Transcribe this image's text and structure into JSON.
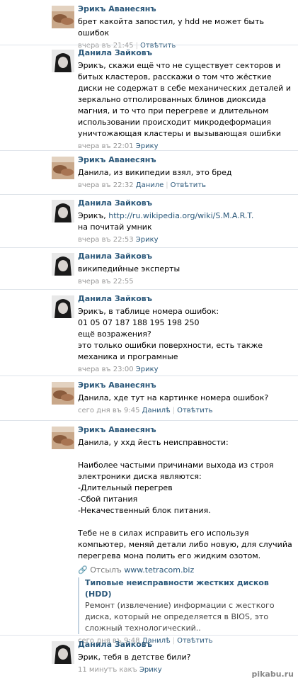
{
  "comments": [
    {
      "author": "Эрикъ Аванесянъ",
      "text": "брет какойта запостил, у hdd не может быть ошибок",
      "meta_time": "вчера въ 21:45",
      "meta_reply": "Отвѣтить",
      "avatar": "avatar-erik"
    },
    {
      "author": "Данила Зайковъ",
      "text": "Эрикъ, скажи ещё что не существует секторов и битых кластеров, расскажи о том что жёсткие диски не содержат в себе механических деталей и зеркально отполированных блинов диоксида магния, и то что при перегреве и длительном использовании происходит микродеформация уничтожающая кластеры и вызывающая ошибки",
      "meta_time": "вчера въ 22:01",
      "meta_to": "Эрику",
      "avatar": "avatar-danila"
    },
    {
      "author": "Эрикъ Аванесянъ",
      "text": "Данила, из википедии взял, это бред",
      "meta_time": "вчера въ 22:32",
      "meta_to": "Даниле",
      "meta_reply": "Отвѣтить",
      "avatar": "avatar-erik"
    },
    {
      "author": "Данила Зайковъ",
      "text_prefix": "Эрикъ, ",
      "link": "http://ru.wikipedia.org/wiki/S.M.A.R.T.",
      "text": "на почитай умник",
      "meta_time": "вчера въ 22:53",
      "meta_to": "Эрику",
      "avatar": "avatar-danila"
    },
    {
      "author": "Данила Зайковъ",
      "text": "википедийные эксперты",
      "meta_time": "вчера въ 22:55",
      "avatar": "avatar-danila"
    },
    {
      "author": "Данила Зайковъ",
      "text": "Эрикъ, в таблице номера ошибок:\n01 05 07 187 188 195 198 250\nещё возражения?\nэто только ошибки поверхности, есть также механика и програмные",
      "meta_time": "вчера въ 23:00",
      "meta_to": "Эрику",
      "avatar": "avatar-danila"
    },
    {
      "author": "Эрикъ Аванесянъ",
      "text": "Данила, хде тут на картинке номера ошибок?",
      "meta_time": "сего дня въ 9:45",
      "meta_to": "Данилѣ",
      "meta_reply": "Отвѣтить",
      "avatar": "avatar-erik"
    },
    {
      "author": "Эрикъ Аванесянъ",
      "text": "Данила, у ххд йесть неисправности:\n\nНаиболее частыми причинами выхода из строя электроники диска являются:\n-Длительный перегрев\n-Сбой питания\n-Некачественный блок питания.\n\nТебе не в силах исправить его используя компьютер, меняй детали либо новую, для случийа перегрева мона полить его жидким озотом.",
      "attachment": {
        "source_label": "Отсылъ",
        "source": "www.tetracom.biz",
        "title": "Типовые неисправности жестких дисков (HDD)",
        "description": "Ремонт (извлечение) информации с жесткого диска, который не определяется в BIOS, это сложный технологический.."
      },
      "meta_time": "сего дня въ 9:48",
      "meta_to": "Данилѣ",
      "meta_reply": "Отвѣтить",
      "avatar": "avatar-erik"
    },
    {
      "author": "Данила Зайковъ",
      "text": "Эрик, тебя в детстве били?",
      "meta_time": "11 минутъ какъ",
      "meta_to": "Эрику",
      "avatar": "avatar-danila"
    }
  ],
  "watermark": "pikabu.ru",
  "colors": {
    "link": "#2b587a",
    "meta": "#999999",
    "separator": "#dfe4ea"
  }
}
